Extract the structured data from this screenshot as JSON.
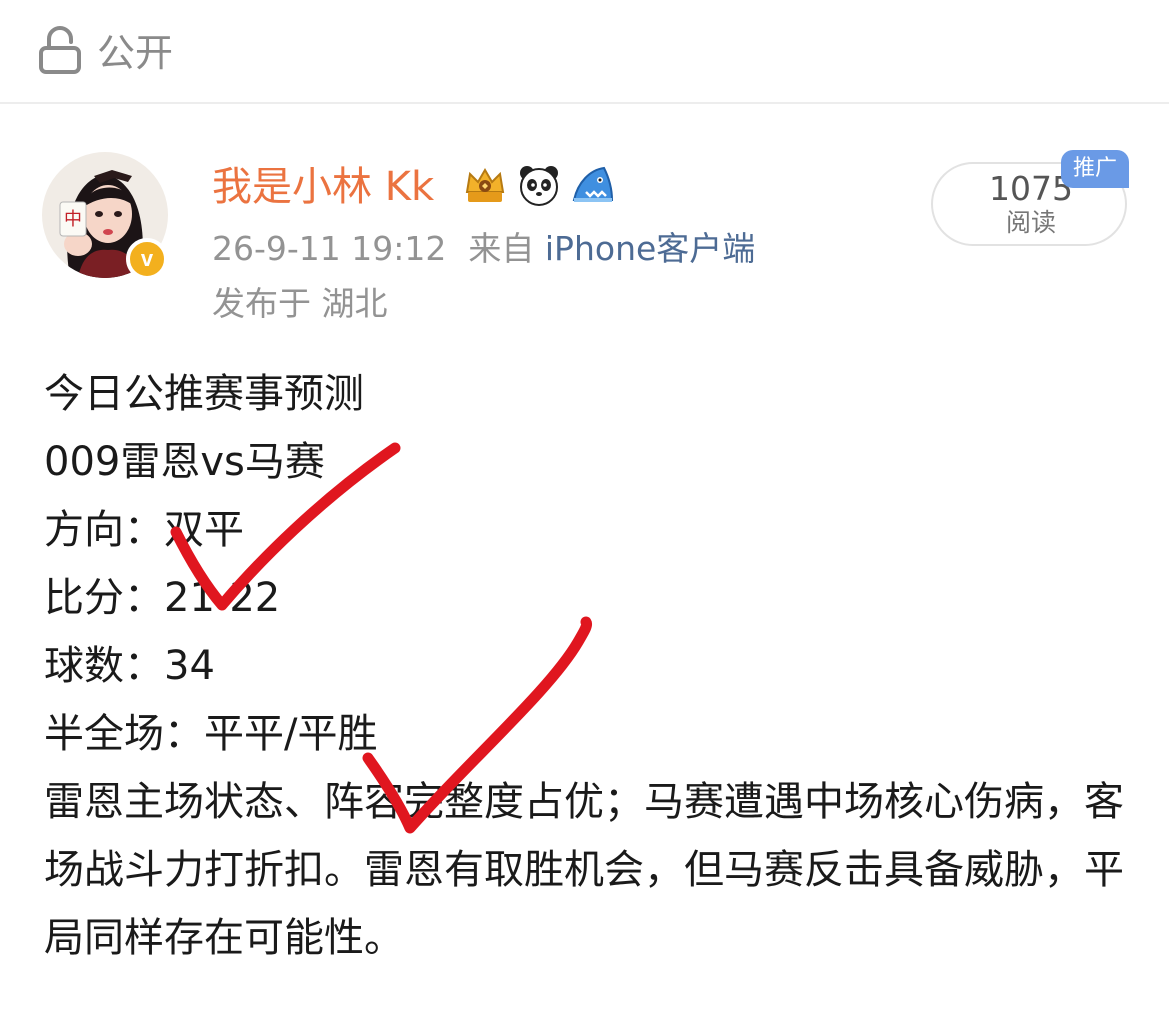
{
  "visibility": {
    "icon": "lock-icon",
    "label": "公开"
  },
  "author": {
    "name": "我是小林 Kk",
    "avatar_icon": "avatar-image",
    "verified_icon": "verified-v-icon",
    "verified_label": "v",
    "badges": [
      "crown-badge-icon",
      "panda-badge-icon",
      "shark-badge-icon"
    ]
  },
  "meta": {
    "date": "26-9-11 19:12",
    "source_prefix": "来自",
    "source": "iPhone客户端",
    "location": "发布于 湖北"
  },
  "reads": {
    "count": "1075",
    "label": "阅读",
    "promo_tag": "推广"
  },
  "post": {
    "lines": [
      "今日公推赛事预测",
      "009雷恩vs马赛",
      "方向：双平",
      "比分：21-22",
      "球数：34",
      "半全场：平平/平胜"
    ],
    "analysis": "雷恩主场状态、阵容完整度占优；马赛遭遇中场核心伤病，客场战斗力打折扣。雷恩有取胜机会，但马赛反击具备威胁，平局同样存在可能性。"
  },
  "annotations": {
    "mark_icon": "red-check-mark-icon",
    "color": "#e0161f"
  },
  "colors": {
    "author_name": "#eb7340",
    "source_link": "#4d6b94",
    "meta_text": "#939393",
    "verified_badge": "#f3b01e",
    "promo_tag": "#6a9ae6"
  }
}
